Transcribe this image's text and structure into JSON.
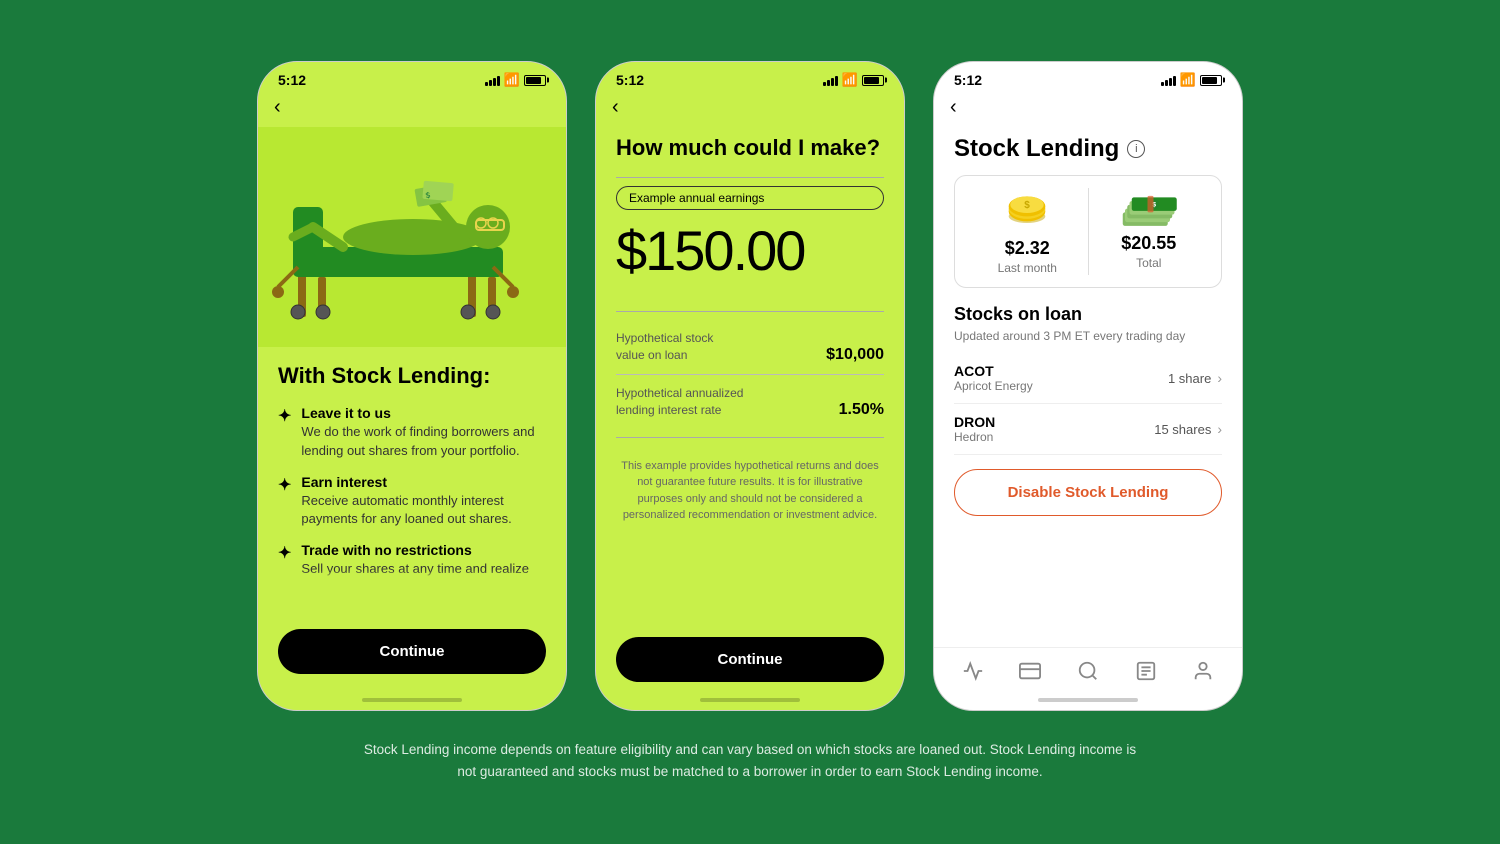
{
  "page": {
    "background": "#1a7a3c",
    "footer_text": "Stock Lending income depends on feature eligibility and can vary based on which stocks are loaned out. Stock Lending income is not guaranteed and stocks must be matched to a borrower in order to earn Stock Lending income."
  },
  "phone1": {
    "status_time": "5:12",
    "title": "With Stock Lending:",
    "features": [
      {
        "title": "Leave it to us",
        "desc": "We do the work of finding borrowers and lending out shares from your portfolio."
      },
      {
        "title": "Earn interest",
        "desc": "Receive automatic monthly interest payments for any loaned out shares."
      },
      {
        "title": "Trade with no restrictions",
        "desc": "Sell your shares at any time and realize"
      }
    ],
    "continue_label": "Continue"
  },
  "phone2": {
    "status_time": "5:12",
    "screen_title": "How much could I make?",
    "earnings_badge": "Example annual earnings",
    "big_amount": "$150.00",
    "inputs": [
      {
        "label": "Hypothetical stock\nvalue on loan",
        "value": "$10,000"
      },
      {
        "label": "Hypothetical annualized\nlending interest rate",
        "value": "1.50%"
      }
    ],
    "disclaimer": "This example provides hypothetical returns and does not guarantee future results. It is for illustrative purposes only and should not be considered a personalized recommendation or investment advice.",
    "continue_label": "Continue"
  },
  "phone3": {
    "status_time": "5:12",
    "page_title": "Stock Lending",
    "earnings": [
      {
        "amount": "$2.32",
        "label": "Last month",
        "icon": "coin"
      },
      {
        "amount": "$20.55",
        "label": "Total",
        "icon": "money-stack"
      }
    ],
    "stocks_section_title": "Stocks on loan",
    "stocks_section_subtitle": "Updated around 3 PM ET every trading day",
    "stocks": [
      {
        "ticker": "ACOT",
        "name": "Apricot Energy",
        "shares": "1 share"
      },
      {
        "ticker": "DRON",
        "name": "Hedron",
        "shares": "15 shares"
      }
    ],
    "disable_label": "Disable Stock Lending",
    "nav_icons": [
      "chart",
      "card",
      "search",
      "news",
      "profile"
    ]
  }
}
